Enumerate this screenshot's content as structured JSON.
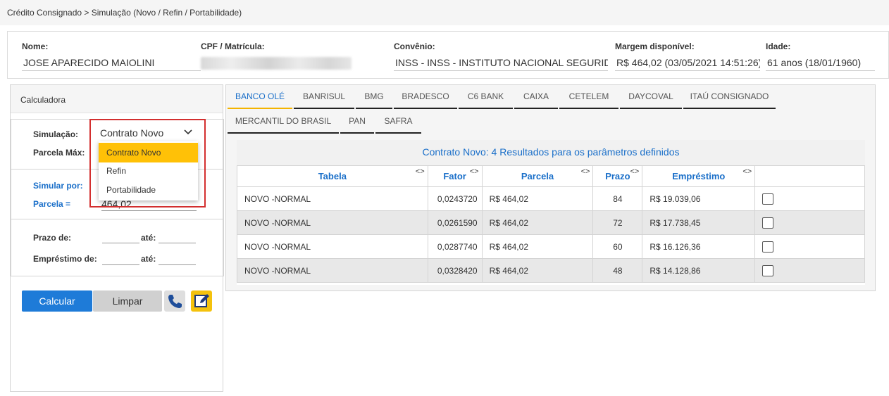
{
  "breadcrumb": "Crédito Consignado > Simulação (Novo / Refin / Portabilidade)",
  "client": {
    "nome_label": "Nome:",
    "nome_value": "JOSE APARECIDO MAIOLINI",
    "cpf_label": "CPF / Matrícula:",
    "convenio_label": "Convênio:",
    "convenio_value": "INSS - INSS - INSTITUTO NACIONAL SEGURIDADE",
    "margem_label": "Margem disponível:",
    "margem_value": "R$ 464,02 (03/05/2021 14:51:26)",
    "idade_label": "Idade:",
    "idade_value": "61 anos (18/01/1960)"
  },
  "calc": {
    "title": "Calculadora",
    "simulacao_label": "Simulação:",
    "simulacao_value": "Contrato Novo",
    "parcela_max_label": "Parcela Máx:",
    "simular_por_label": "Simular por:",
    "parcela_eq_label": "Parcela =",
    "parcela_value": "464,02",
    "prazo_de_label": "Prazo de:",
    "emprestimo_de_label": "Empréstimo de:",
    "ate_label": "até:",
    "calcular_label": "Calcular",
    "limpar_label": "Limpar",
    "dropdown_options": [
      "Contrato Novo",
      "Refin",
      "Portabilidade"
    ]
  },
  "banks": {
    "row1": [
      "BANCO OLÉ",
      "BANRISUL",
      "BMG",
      "BRADESCO",
      "C6 BANK",
      "CAIXA",
      "CETELEM",
      "DAYCOVAL",
      "ITAÚ CONSIGNADO"
    ],
    "row2": [
      "MERCANTIL DO BRASIL",
      "PAN",
      "SAFRA"
    ]
  },
  "results": {
    "title": "Contrato Novo: 4 Resultados para os parâmetros definidos",
    "sort_glyph": "<>",
    "columns": [
      "Tabela",
      "Fator",
      "Parcela",
      "Prazo",
      "Empréstimo"
    ],
    "rows": [
      {
        "tabela": "NOVO -NORMAL",
        "fator": "0,0243720",
        "parcela": "R$ 464,02",
        "prazo": "84",
        "emprestimo": "R$ 19.039,06"
      },
      {
        "tabela": "NOVO -NORMAL",
        "fator": "0,0261590",
        "parcela": "R$ 464,02",
        "prazo": "72",
        "emprestimo": "R$ 17.738,45"
      },
      {
        "tabela": "NOVO -NORMAL",
        "fator": "0,0287740",
        "parcela": "R$ 464,02",
        "prazo": "60",
        "emprestimo": "R$ 16.126,36"
      },
      {
        "tabela": "NOVO -NORMAL",
        "fator": "0,0328420",
        "parcela": "R$ 464,02",
        "prazo": "48",
        "emprestimo": "R$ 14.128,86"
      }
    ]
  },
  "colors": {
    "accent_blue": "#1a6fc9",
    "button_blue": "#1e7bd8",
    "tab_active": "#f4b400",
    "highlight_red": "#d32f2f",
    "dropdown_selected": "#ffc107"
  },
  "icons": [
    "phone-icon",
    "edit-icon",
    "chevron-down-icon",
    "sort-icon",
    "checkbox-icon"
  ]
}
